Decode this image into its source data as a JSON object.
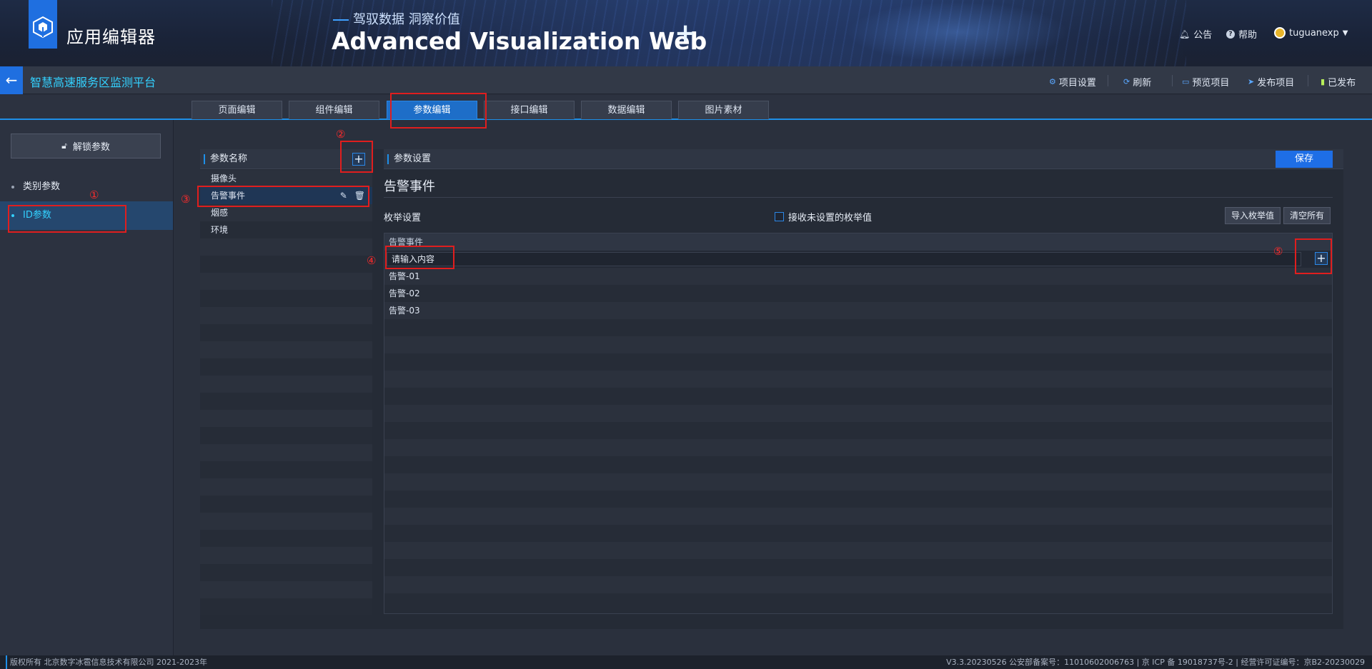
{
  "header": {
    "app_title": "应用编辑器",
    "slogan": "驾驭数据 洞察价值",
    "banner_title": "Advanced Visualization Web",
    "announce": "公告",
    "help": "帮助",
    "username": "tuguanexp"
  },
  "project_bar": {
    "project_name": "智慧高速服务区监测平台",
    "buttons": [
      "项目设置",
      "刷新",
      "预览项目",
      "发布项目",
      "已发布"
    ]
  },
  "tabs": [
    "页面编辑",
    "组件编辑",
    "参数编辑",
    "接口编辑",
    "数据编辑",
    "图片素材"
  ],
  "left_nav": {
    "unlock_label": "解锁参数",
    "items": [
      "类别参数",
      "ID参数"
    ]
  },
  "param_list": {
    "header": "参数名称",
    "items": [
      "摄像头",
      "告警事件",
      "烟感",
      "环境"
    ]
  },
  "settings": {
    "header": "参数设置",
    "save_label": "保存",
    "title": "告警事件",
    "enum_label": "枚举设置",
    "accept_unset_label": "接收未设置的枚举值",
    "import_label": "导入枚举值",
    "clear_label": "清空所有",
    "table_header": "告警事件",
    "input_placeholder": "请输入内容",
    "enum_values": [
      "告警-01",
      "告警-02",
      "告警-03"
    ]
  },
  "annotations": [
    "①",
    "②",
    "③",
    "④",
    "⑤"
  ],
  "footer": {
    "left": "版权所有 北京数字冰雹信息技术有限公司 2021-2023年",
    "right": "V3.3.20230526 公安部备案号：11010602006763 | 京 ICP 备 19018737号-2 | 经营许可证编号：京B2-20230029"
  },
  "colors": {
    "accent": "#1e8fe8",
    "highlight_text": "#33d1ff",
    "annotation": "#e01e1e"
  }
}
